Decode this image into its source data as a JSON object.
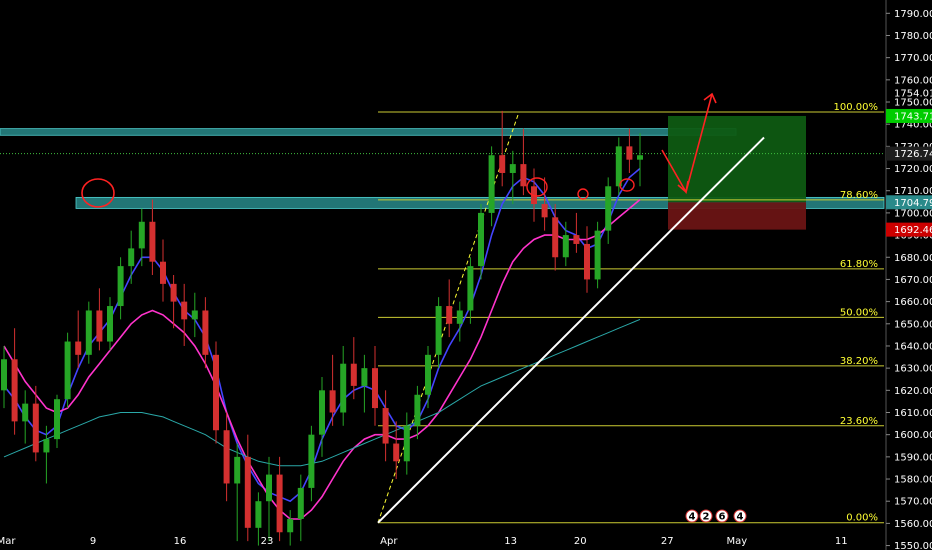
{
  "chart_data": {
    "type": "candlestick",
    "y_axis": {
      "range": [
        1548,
        1796
      ],
      "ticks": [
        1550,
        1560,
        1570,
        1580,
        1590,
        1600,
        1610,
        1620,
        1630,
        1640,
        1650,
        1660,
        1670,
        1680,
        1690,
        1700,
        1710,
        1720,
        1730,
        1740,
        1750,
        1760,
        1770,
        1780,
        1790
      ],
      "tick_labels": [
        "1550.00",
        "1560.00",
        "1570.00",
        "1580.00",
        "1590.00",
        "1600.00",
        "1610.00",
        "1620.00",
        "1630.00",
        "1640.00",
        "1650.00",
        "1660.00",
        "1670.00",
        "1680.00",
        "1690.00",
        "1700.00",
        "1710.00",
        "1720.00",
        "1730.00",
        "1740.00",
        "1750.00",
        "1760.00",
        "1770.00",
        "1780.00",
        "1790.00"
      ]
    },
    "x_axis": {
      "labels": [
        {
          "text": "Mar",
          "session": 0
        },
        {
          "text": "9",
          "session": 5
        },
        {
          "text": "16",
          "session": 10
        },
        {
          "text": "23",
          "session": 15
        },
        {
          "text": "Apr",
          "session": 22
        },
        {
          "text": "13",
          "session": 29
        },
        {
          "text": "20",
          "session": 33
        },
        {
          "text": "27",
          "session": 38
        },
        {
          "text": "May",
          "session": 42
        },
        {
          "text": "11",
          "session": 48
        }
      ]
    },
    "price_labels": [
      {
        "text": "1754.01",
        "value": 1754.01,
        "style": "plain"
      },
      {
        "text": "1743.71",
        "value": 1743.71,
        "color": "#00cc00"
      },
      {
        "text": "1726.74",
        "value": 1726.74,
        "color": "#1e1e1e"
      },
      {
        "text": "1704.79",
        "value": 1704.79,
        "color": "#2a8a8a"
      },
      {
        "text": "1692.46",
        "value": 1692.46,
        "color": "#cc0000"
      }
    ],
    "fibonacci": {
      "high": 1745.5,
      "low": 1560.3,
      "levels": [
        {
          "label": "100.00%",
          "ratio": 1.0
        },
        {
          "label": "78.60%",
          "ratio": 0.786
        },
        {
          "label": "61.80%",
          "ratio": 0.618
        },
        {
          "label": "50.00%",
          "ratio": 0.5
        },
        {
          "label": "38.20%",
          "ratio": 0.382
        },
        {
          "label": "23.60%",
          "ratio": 0.236
        },
        {
          "label": "0.00%",
          "ratio": 0.0
        }
      ],
      "color": "#cccc33"
    },
    "zones": [
      {
        "name": "resistance",
        "low": 1735,
        "high": 1738,
        "color": "#2e9e9e"
      },
      {
        "name": "support",
        "low": 1702,
        "high": 1707,
        "color": "#2e9e9e"
      }
    ],
    "trade_box": {
      "entry": 1704.79,
      "target": 1743.71,
      "stop": 1692.46,
      "profit_color": "#0e5a12",
      "loss_color": "#6a1414"
    },
    "trendline": {
      "from": [
        0,
        1560.3
      ],
      "to": [
        1,
        1734
      ],
      "color": "#ffffff"
    },
    "current_price": 1726.74,
    "candles": [
      [
        1620,
        1640,
        1612,
        1634
      ],
      [
        1634,
        1648,
        1600,
        1606
      ],
      [
        1606,
        1620,
        1596,
        1614
      ],
      [
        1614,
        1622,
        1588,
        1592
      ],
      [
        1592,
        1604,
        1578,
        1598
      ],
      [
        1598,
        1618,
        1594,
        1616
      ],
      [
        1616,
        1646,
        1612,
        1642
      ],
      [
        1642,
        1656,
        1630,
        1636
      ],
      [
        1636,
        1660,
        1632,
        1656
      ],
      [
        1656,
        1666,
        1638,
        1642
      ],
      [
        1642,
        1662,
        1638,
        1658
      ],
      [
        1658,
        1680,
        1652,
        1676
      ],
      [
        1676,
        1692,
        1668,
        1684
      ],
      [
        1684,
        1702,
        1676,
        1696
      ],
      [
        1696,
        1706,
        1672,
        1678
      ],
      [
        1678,
        1688,
        1660,
        1668
      ],
      [
        1668,
        1672,
        1648,
        1660
      ],
      [
        1660,
        1668,
        1640,
        1652
      ],
      [
        1652,
        1664,
        1644,
        1656
      ],
      [
        1656,
        1662,
        1630,
        1636
      ],
      [
        1636,
        1642,
        1596,
        1602
      ],
      [
        1602,
        1610,
        1570,
        1578
      ],
      [
        1578,
        1596,
        1552,
        1590
      ],
      [
        1590,
        1600,
        1552,
        1558
      ],
      [
        1558,
        1574,
        1550,
        1570
      ],
      [
        1570,
        1590,
        1552,
        1582
      ],
      [
        1582,
        1590,
        1552,
        1556
      ],
      [
        1556,
        1566,
        1550,
        1562
      ],
      [
        1562,
        1582,
        1552,
        1576
      ],
      [
        1576,
        1604,
        1570,
        1600
      ],
      [
        1600,
        1626,
        1590,
        1620
      ],
      [
        1620,
        1636,
        1604,
        1610
      ],
      [
        1610,
        1640,
        1604,
        1632
      ],
      [
        1632,
        1644,
        1616,
        1622
      ],
      [
        1622,
        1636,
        1610,
        1630
      ],
      [
        1630,
        1640,
        1604,
        1612
      ],
      [
        1612,
        1620,
        1588,
        1596
      ],
      [
        1596,
        1606,
        1580,
        1588
      ],
      [
        1588,
        1610,
        1582,
        1604
      ],
      [
        1604,
        1622,
        1598,
        1618
      ],
      [
        1618,
        1640,
        1612,
        1636
      ],
      [
        1636,
        1662,
        1630,
        1658
      ],
      [
        1658,
        1670,
        1644,
        1650
      ],
      [
        1650,
        1660,
        1642,
        1656
      ],
      [
        1656,
        1680,
        1650,
        1676
      ],
      [
        1676,
        1704,
        1670,
        1700
      ],
      [
        1700,
        1730,
        1694,
        1726
      ],
      [
        1726,
        1746,
        1712,
        1718
      ],
      [
        1718,
        1728,
        1704,
        1722
      ],
      [
        1722,
        1738,
        1708,
        1712
      ],
      [
        1712,
        1720,
        1696,
        1704
      ],
      [
        1704,
        1716,
        1692,
        1698
      ],
      [
        1698,
        1704,
        1674,
        1680
      ],
      [
        1680,
        1696,
        1676,
        1690
      ],
      [
        1690,
        1700,
        1682,
        1686
      ],
      [
        1686,
        1694,
        1664,
        1670
      ],
      [
        1670,
        1696,
        1666,
        1692
      ],
      [
        1692,
        1716,
        1686,
        1712
      ],
      [
        1712,
        1734,
        1708,
        1730
      ],
      [
        1730,
        1738,
        1718,
        1724
      ],
      [
        1724,
        1736,
        1712,
        1726
      ]
    ],
    "moving_averages": [
      {
        "name": "fast",
        "color": "#4444ff",
        "values": [
          1622,
          1616,
          1608,
          1602,
          1600,
          1604,
          1618,
          1630,
          1640,
          1646,
          1652,
          1662,
          1672,
          1680,
          1680,
          1674,
          1664,
          1656,
          1652,
          1644,
          1630,
          1610,
          1596,
          1586,
          1578,
          1574,
          1572,
          1570,
          1574,
          1584,
          1598,
          1608,
          1616,
          1620,
          1622,
          1620,
          1612,
          1604,
          1602,
          1606,
          1616,
          1630,
          1640,
          1648,
          1658,
          1672,
          1690,
          1704,
          1712,
          1716,
          1714,
          1708,
          1698,
          1692,
          1690,
          1684,
          1686,
          1696,
          1708,
          1716,
          1720
        ]
      },
      {
        "name": "medium",
        "color": "#ff33cc",
        "values": [
          1640,
          1632,
          1624,
          1618,
          1612,
          1610,
          1612,
          1618,
          1626,
          1632,
          1638,
          1644,
          1650,
          1654,
          1656,
          1654,
          1650,
          1646,
          1640,
          1632,
          1622,
          1610,
          1598,
          1588,
          1580,
          1572,
          1566,
          1562,
          1562,
          1566,
          1572,
          1580,
          1588,
          1594,
          1598,
          1600,
          1600,
          1598,
          1598,
          1600,
          1604,
          1610,
          1618,
          1626,
          1634,
          1644,
          1656,
          1668,
          1678,
          1684,
          1688,
          1690,
          1690,
          1688,
          1688,
          1688,
          1690,
          1694,
          1698,
          1702,
          1706
        ]
      },
      {
        "name": "slow",
        "color": "#2aa8a8",
        "values": [
          1590,
          1592,
          1594,
          1596,
          1598,
          1600,
          1602,
          1604,
          1606,
          1608,
          1609,
          1610,
          1610,
          1610,
          1609,
          1608,
          1606,
          1604,
          1602,
          1600,
          1597,
          1594,
          1592,
          1590,
          1588,
          1587,
          1586,
          1586,
          1586,
          1587,
          1588,
          1590,
          1592,
          1594,
          1596,
          1598,
          1600,
          1602,
          1604,
          1606,
          1608,
          1610,
          1613,
          1616,
          1619,
          1622,
          1624,
          1626,
          1628,
          1630,
          1632,
          1634,
          1636,
          1638,
          1640,
          1642,
          1644,
          1646,
          1648,
          1650,
          1652
        ]
      }
    ],
    "event_badges": [
      "4",
      "2",
      "6",
      "4"
    ]
  }
}
